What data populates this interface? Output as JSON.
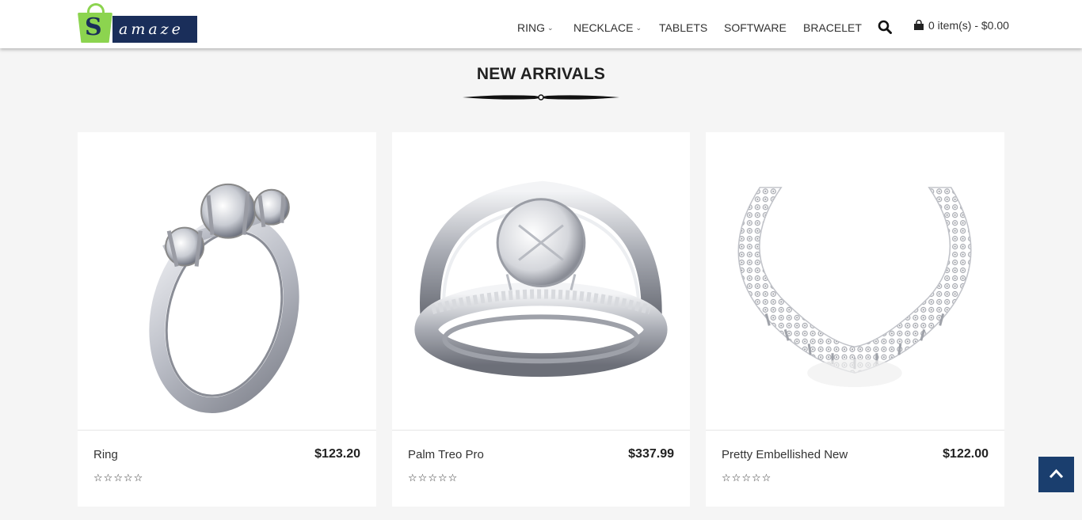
{
  "brand": {
    "logo_letter": "S",
    "logo_text": "amaze"
  },
  "nav": {
    "items": [
      {
        "label": "RING",
        "has_dropdown": true
      },
      {
        "label": "NECKLACE",
        "has_dropdown": true
      },
      {
        "label": "TABLETS",
        "has_dropdown": false
      },
      {
        "label": "SOFTWARE",
        "has_dropdown": false
      },
      {
        "label": "BRACELET",
        "has_dropdown": false
      }
    ],
    "search_icon": "search-icon",
    "cart_icon": "shopping-bag-icon",
    "cart_text": "0 item(s) - $0.00"
  },
  "section": {
    "title": "NEW ARRIVALS"
  },
  "products": [
    {
      "name": "Ring",
      "price": "$123.20",
      "rating": 0,
      "max_rating": 5,
      "image": "three-stone-ring"
    },
    {
      "name": "Palm Treo Pro",
      "price": "$337.99",
      "rating": 0,
      "max_rating": 5,
      "image": "solitaire-band-ring"
    },
    {
      "name": "Pretty Embellished New",
      "price": "$122.00",
      "rating": 0,
      "max_rating": 5,
      "image": "diamond-necklace"
    }
  ],
  "back_to_top_icon": "chevron-up-icon",
  "colors": {
    "brand_navy": "#1a2e5a",
    "brand_green": "#8cd44f",
    "back_to_top": "#1a3e6e",
    "page_bg": "#f5f5f5"
  }
}
